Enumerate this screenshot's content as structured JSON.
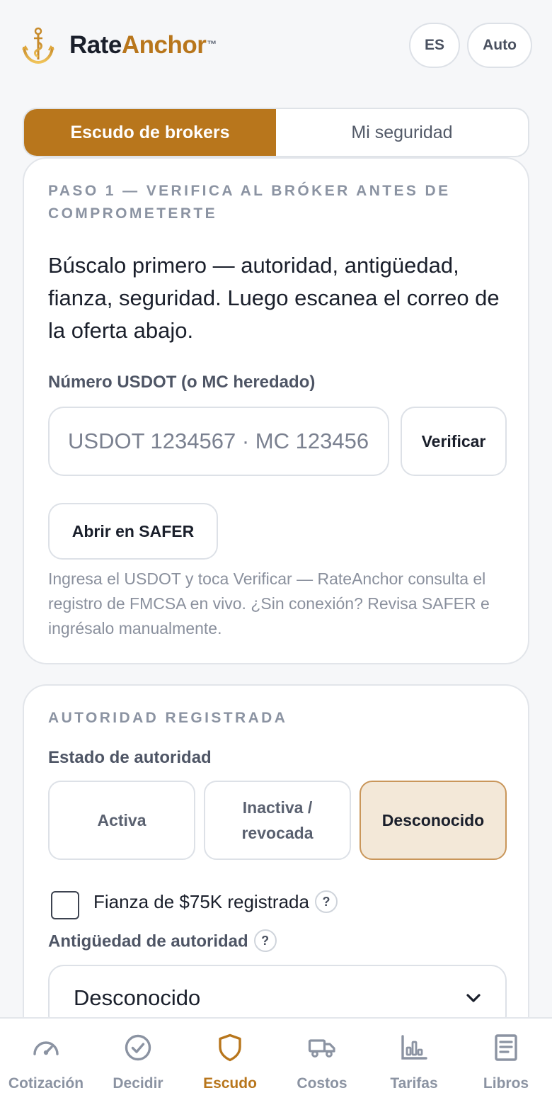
{
  "header": {
    "brand_part1": "Rate",
    "brand_part2": "Anchor",
    "brand_tm": "™",
    "lang_label": "ES",
    "theme_label": "Auto"
  },
  "tabs": [
    {
      "label": "Escudo de brokers",
      "active": true
    },
    {
      "label": "Mi seguridad",
      "active": false
    }
  ],
  "step1": {
    "eyebrow": "PASO 1 — VERIFICA AL BRÓKER ANTES DE COMPROMETERTE",
    "lead": "Búscalo primero — autoridad, antigüedad, fianza, seguridad. Luego escanea el correo de la oferta abajo.",
    "usdot_label": "Número USDOT (o MC heredado)",
    "usdot_placeholder": "USDOT 1234567 · MC 123456",
    "usdot_value": "",
    "verify_label": "Verificar",
    "safer_label": "Abrir en SAFER",
    "help_text": "Ingresa el USDOT y toca Verificar — RateAnchor consulta el registro de FMCSA en vivo. ¿Sin conexión? Revisa SAFER e ingrésalo manualmente."
  },
  "authority": {
    "eyebrow": "AUTORIDAD REGISTRADA",
    "status_label": "Estado de autoridad",
    "status_options": [
      "Activa",
      "Inactiva / revocada",
      "Desconocido"
    ],
    "status_selected": "Desconocido",
    "bond_label": "Fianza de $75K registrada",
    "bond_checked": false,
    "help_glyph": "?",
    "age_label": "Antigüedad de autoridad",
    "age_value": "Desconocido"
  },
  "nav": [
    {
      "label": "Cotización",
      "icon": "gauge-icon",
      "active": false
    },
    {
      "label": "Decidir",
      "icon": "check-circle-icon",
      "active": false
    },
    {
      "label": "Escudo",
      "icon": "shield-icon",
      "active": true
    },
    {
      "label": "Costos",
      "icon": "truck-icon",
      "active": false
    },
    {
      "label": "Tarifas",
      "icon": "bar-chart-icon",
      "active": false
    },
    {
      "label": "Libros",
      "icon": "document-icon",
      "active": false
    }
  ],
  "colors": {
    "accent": "#b8761c",
    "selected_bg": "#f3e8d8",
    "background": "#f6f7f9"
  }
}
